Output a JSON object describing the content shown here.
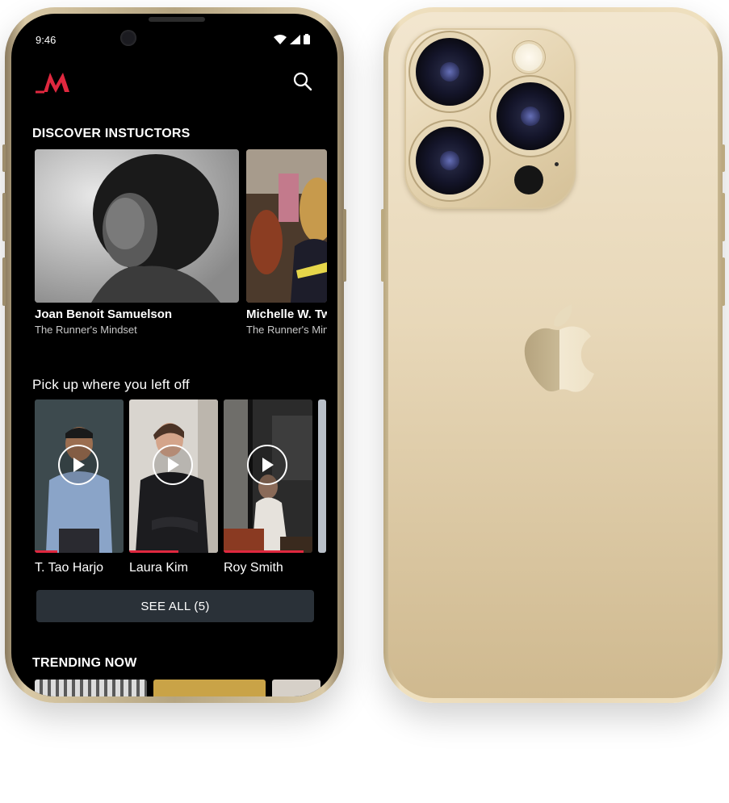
{
  "status_bar": {
    "time": "9:46"
  },
  "app": {
    "brand_color": "#e0283f",
    "logo_icon": "m-logo-icon",
    "search_icon": "search-icon"
  },
  "sections": {
    "discover_title": "DISCOVER INSTUCTORS",
    "continue_title": "Pick up where you left off",
    "trending_title": "TRENDING NOW"
  },
  "instructors": [
    {
      "name": "Joan Benoit Samuelson",
      "course": "The Runner's Mindset"
    },
    {
      "name": "Michelle W. Tw",
      "course": "The Runner's Min"
    }
  ],
  "continue_watching": [
    {
      "name": "T. Tao Harjo",
      "progress": 0.25
    },
    {
      "name": "Laura Kim",
      "progress": 0.55
    },
    {
      "name": "Roy Smith",
      "progress": 0.9
    }
  ],
  "see_all_label": "SEE ALL (5)"
}
